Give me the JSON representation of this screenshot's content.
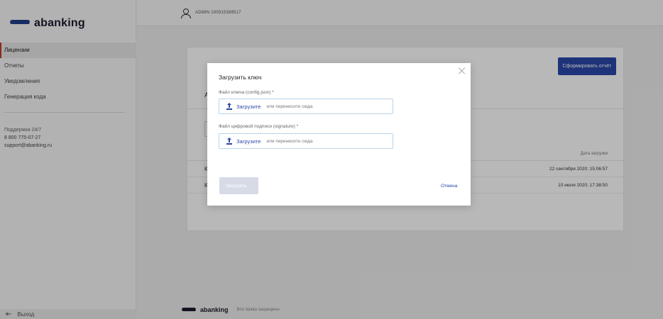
{
  "brand": {
    "name": "abanking"
  },
  "header": {
    "user": "ADMIN 100915389517"
  },
  "sidebar": {
    "items": [
      {
        "label": "Лицензии",
        "active": true
      },
      {
        "label": "Отчеты",
        "active": false
      },
      {
        "label": "Уведомления",
        "active": false
      },
      {
        "label": "Генерация кода",
        "active": false
      }
    ],
    "support": {
      "title": "Поддержка 24/7",
      "phone": "8 800 775-07-27",
      "email": "support@abanking.ru"
    },
    "logout_label": "Выход"
  },
  "card": {
    "report_button": "Сформировать отчёт",
    "title_initial": "А",
    "table": {
      "date_header": "Дата загрузки",
      "rows": [
        {
          "initial": "К",
          "date": "22 сентября 2020; 15:06:57"
        },
        {
          "initial": "К",
          "date": "10 июля 2020; 17:38:50"
        }
      ]
    }
  },
  "footer": {
    "rights": "Все права защищены"
  },
  "modal": {
    "title": "Загрузить ключ",
    "fields": [
      {
        "label": "Файл ключа (config.json) *",
        "link": "Загрузите",
        "rest": "или перенесите сюда"
      },
      {
        "label": "Файл цифровой подписи (signature) *",
        "link": "Загрузите",
        "rest": "или перенесите сюда"
      }
    ],
    "submit_label": "Загрузить",
    "cancel_label": "Отмена"
  },
  "colors": {
    "accent": "#2a47a8",
    "active_marker": "#c0392b"
  },
  "icons": [
    "user-icon",
    "logout-icon",
    "upload-icon",
    "close-icon"
  ]
}
